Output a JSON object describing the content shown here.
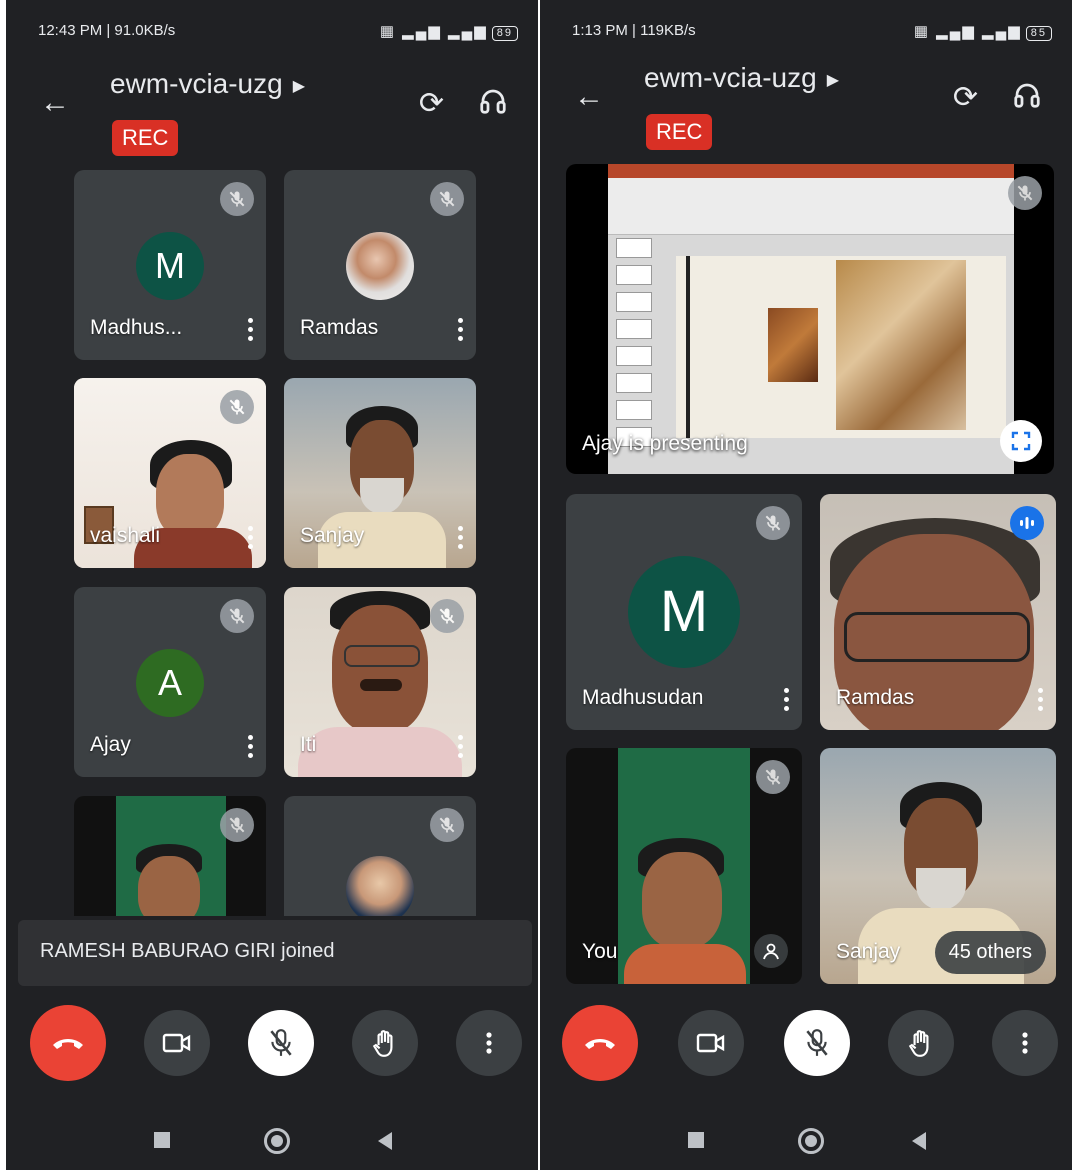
{
  "left": {
    "status": {
      "time": "12:43 PM | 91.0KB/s",
      "battery": "89"
    },
    "meeting_code": "ewm-vcia-uzg",
    "rec_label": "REC",
    "tiles": [
      {
        "name": "Madhus...",
        "type": "avatar",
        "initial": "M",
        "avatar_color": "#0d5345",
        "muted": true
      },
      {
        "name": "Ramdas",
        "type": "photo",
        "muted": true
      },
      {
        "name": "vaishali",
        "type": "video",
        "muted": true
      },
      {
        "name": "Sanjay",
        "type": "video",
        "muted": false
      },
      {
        "name": "Ajay",
        "type": "avatar",
        "initial": "A",
        "avatar_color": "#2e6b22",
        "muted": true
      },
      {
        "name": "Iti",
        "type": "video",
        "muted": true
      },
      {
        "name": "",
        "type": "video",
        "muted": true
      },
      {
        "name": "",
        "type": "photo",
        "muted": true
      }
    ],
    "toast": "RAMESH BABURAO GIRI joined"
  },
  "right": {
    "status": {
      "time": "1:13 PM | 119KB/s",
      "battery": "85"
    },
    "meeting_code": "ewm-vcia-uzg",
    "rec_label": "REC",
    "presenting_caption": "Ajay is presenting",
    "tiles": [
      {
        "name": "Madhusudan",
        "type": "avatar",
        "initial": "M",
        "avatar_color": "#0d5345",
        "muted": true
      },
      {
        "name": "Ramdas",
        "type": "video",
        "speaking": true
      },
      {
        "name": "You",
        "type": "video",
        "muted": true
      },
      {
        "name": "Sanjay",
        "type": "video",
        "muted": false
      }
    ],
    "others_count": "45 others"
  },
  "colors": {
    "bg": "#202124",
    "tile": "#3c4043",
    "end_call": "#ea4335",
    "rec": "#d93025"
  },
  "icons": [
    "back-arrow-icon",
    "camera-flip-icon",
    "headphones-icon",
    "mic-off-icon",
    "more-vert-icon",
    "end-call-icon",
    "camera-icon",
    "raise-hand-icon",
    "fullscreen-icon",
    "speaking-icon"
  ]
}
